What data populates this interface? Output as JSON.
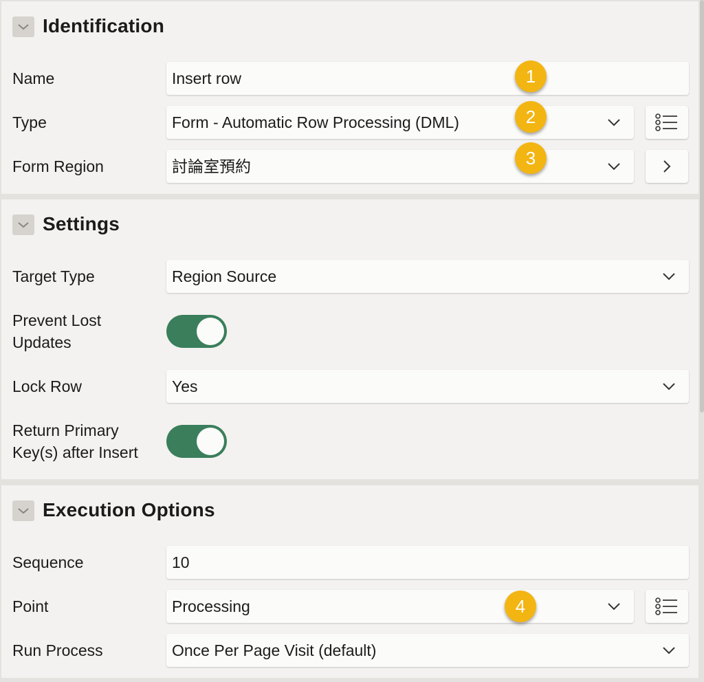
{
  "identification": {
    "title": "Identification",
    "name_label": "Name",
    "name_value": "Insert row",
    "type_label": "Type",
    "type_value": "Form - Automatic Row Processing (DML)",
    "form_region_label": "Form Region",
    "form_region_value": "討論室預約"
  },
  "settings": {
    "title": "Settings",
    "target_type_label": "Target Type",
    "target_type_value": "Region Source",
    "prevent_lost_updates_label_1": "Prevent Lost",
    "prevent_lost_updates_label_2": "Updates",
    "prevent_lost_updates_on": true,
    "lock_row_label": "Lock Row",
    "lock_row_value": "Yes",
    "return_pk_label_1": "Return Primary",
    "return_pk_label_2": "Key(s) after Insert",
    "return_pk_on": true
  },
  "execution": {
    "title": "Execution Options",
    "sequence_label": "Sequence",
    "sequence_value": "10",
    "point_label": "Point",
    "point_value": "Processing",
    "run_process_label": "Run Process",
    "run_process_value": "Once Per Page Visit (default)"
  },
  "callouts": [
    "1",
    "2",
    "3",
    "4"
  ],
  "colors": {
    "toggle_on": "#3a7e5b",
    "callout": "#f3b512"
  }
}
